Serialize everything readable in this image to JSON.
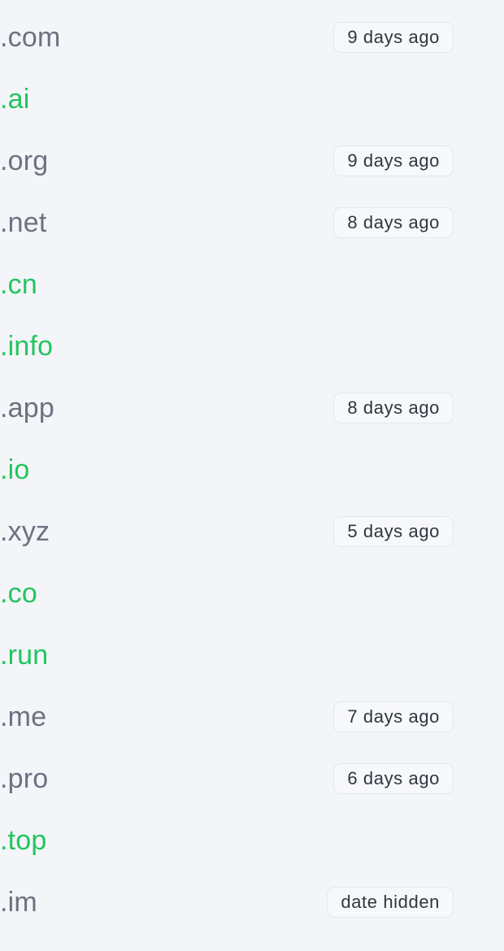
{
  "colors": {
    "background": "#f3f5f8",
    "taken_text": "#6b7280",
    "available_text": "#22c55e",
    "badge_border": "#e3e7ec",
    "badge_text": "#2f3640"
  },
  "domains": [
    {
      "tld": ".com",
      "status": "taken",
      "badge": "9 days ago"
    },
    {
      "tld": ".ai",
      "status": "available",
      "badge": ""
    },
    {
      "tld": ".org",
      "status": "taken",
      "badge": "9 days ago"
    },
    {
      "tld": ".net",
      "status": "taken",
      "badge": "8 days ago"
    },
    {
      "tld": ".cn",
      "status": "available",
      "badge": ""
    },
    {
      "tld": ".info",
      "status": "available",
      "badge": ""
    },
    {
      "tld": ".app",
      "status": "taken",
      "badge": "8 days ago"
    },
    {
      "tld": ".io",
      "status": "available",
      "badge": ""
    },
    {
      "tld": ".xyz",
      "status": "taken",
      "badge": "5 days ago"
    },
    {
      "tld": ".co",
      "status": "available",
      "badge": ""
    },
    {
      "tld": ".run",
      "status": "available",
      "badge": ""
    },
    {
      "tld": ".me",
      "status": "taken",
      "badge": "7 days ago"
    },
    {
      "tld": ".pro",
      "status": "taken",
      "badge": "6 days ago"
    },
    {
      "tld": ".top",
      "status": "available",
      "badge": ""
    },
    {
      "tld": ".im",
      "status": "taken",
      "badge": "date hidden"
    }
  ]
}
